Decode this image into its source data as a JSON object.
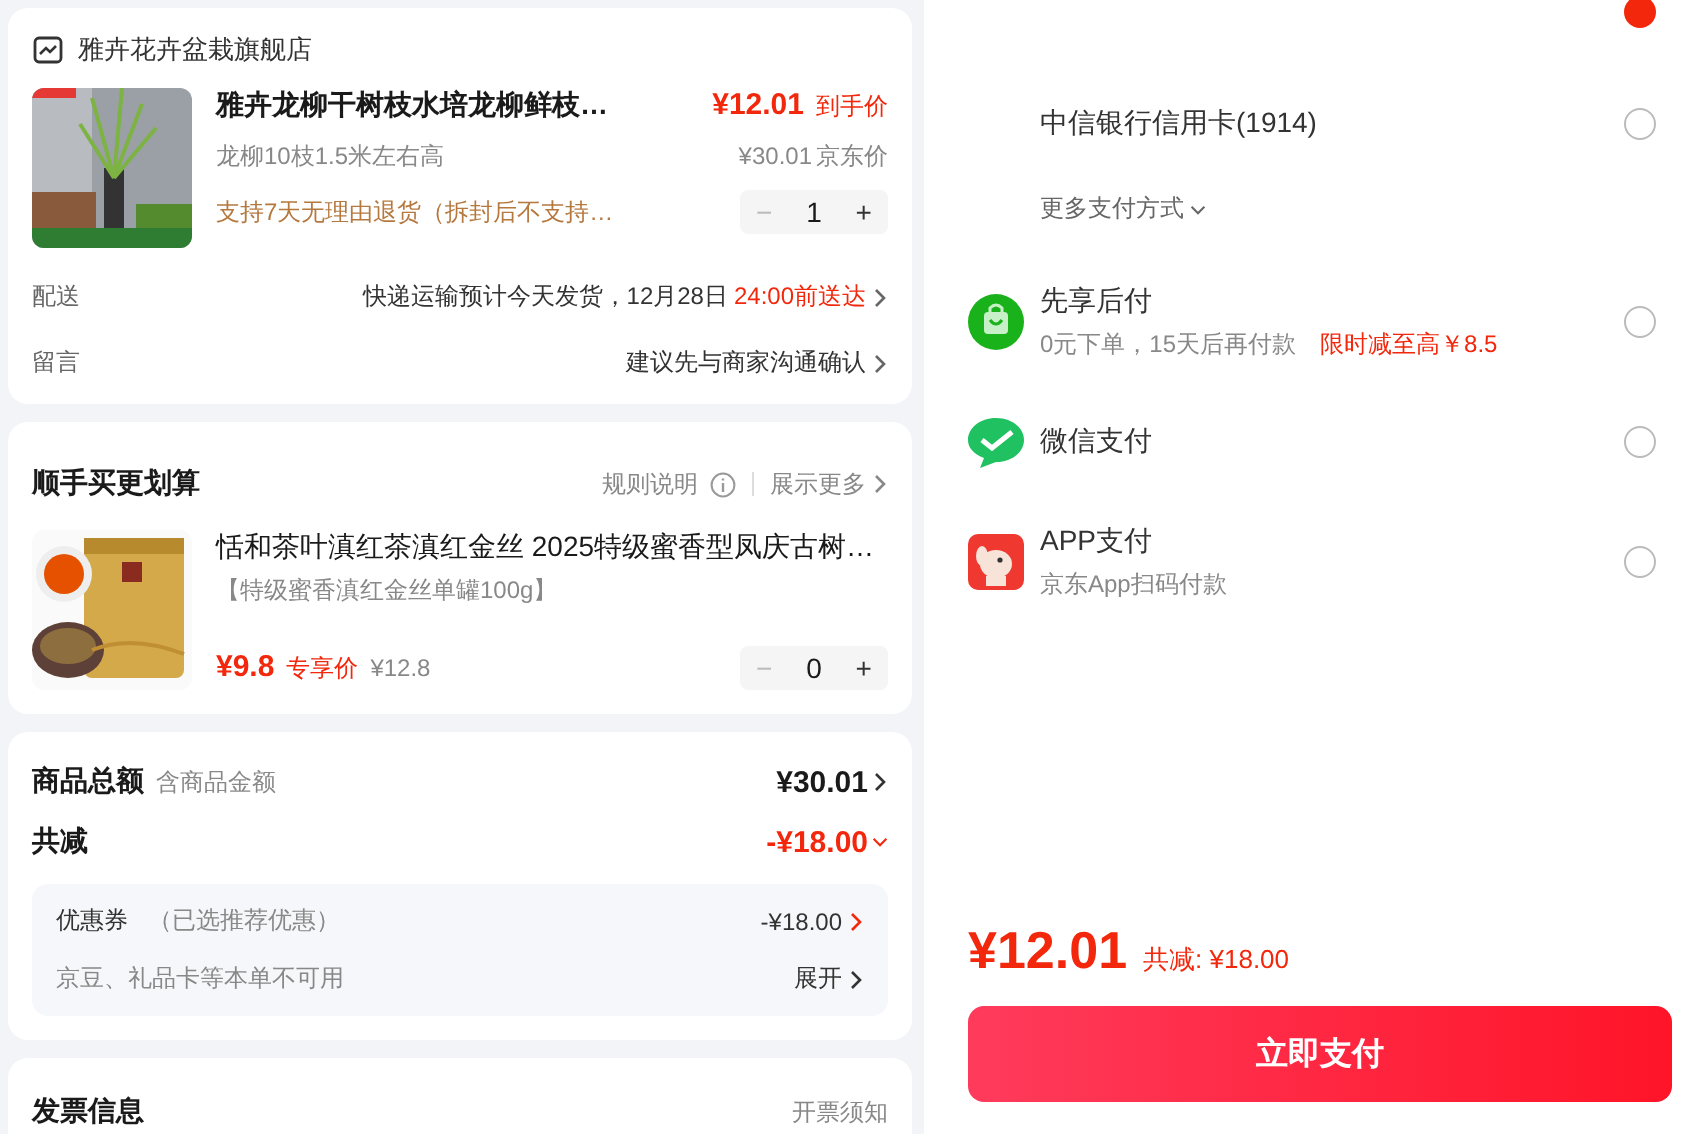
{
  "store": {
    "name": "雅卉花卉盆栽旗舰店"
  },
  "item": {
    "title": "雅卉龙柳干树枝水培龙柳鲜枝…",
    "price": "¥12.01",
    "price_label": "到手价",
    "spec": "龙柳10枝1.5米左右高",
    "list_price": "¥30.01",
    "list_price_label": "京东价",
    "return_policy": "支持7天无理由退货（拆封后不支持…",
    "minus": "−",
    "quantity": "1",
    "plus": "+"
  },
  "details": [
    {
      "label": "配送",
      "value": "快递运输预计今天发货，12月28日",
      "highlight": "24:00前送达"
    },
    {
      "label": "留言",
      "value": "建议先与商家沟通确认"
    }
  ],
  "addon": {
    "title": "顺手买更划算",
    "rules": "规则说明",
    "more": "展示更多",
    "item": {
      "title": "恬和茶叶滇红茶滇红金丝 2025特级蜜香型凤庆古树…",
      "spec": "【特级蜜香滇红金丝单罐100g】",
      "price": "¥9.8",
      "price_label": "专享价",
      "list_price": "¥12.8",
      "minus": "−",
      "quantity": "0",
      "plus": "+"
    }
  },
  "summary": {
    "rows": [
      {
        "kind": "total",
        "label": "商品总额",
        "note": "含商品金额",
        "value": "¥30.01"
      },
      {
        "kind": "discount",
        "label": "共减",
        "value": "-¥18.00"
      }
    ],
    "coupon": {
      "label": "优惠券",
      "note": "（已选推荐优惠）",
      "value": "-¥18.00"
    },
    "beans": {
      "label": "京豆、礼品卡等本单不可用",
      "action": "展开"
    }
  },
  "invoice": {
    "title": "发票信息",
    "notice": "开票须知"
  },
  "payment": {
    "methods": [
      {
        "kind": "clipped",
        "selected": true
      },
      {
        "kind": "card",
        "name": "中信银行信用卡(1914)",
        "selected": false
      }
    ],
    "more": "更多支付方式",
    "other_methods": [
      {
        "kind": "bnpl",
        "name": "先享后付",
        "sub": "0元下单，15天后再付款",
        "promo": "限时减至高￥8.5",
        "selected": false
      },
      {
        "kind": "wechat",
        "name": "微信支付",
        "selected": false
      },
      {
        "kind": "app",
        "name": "APP支付",
        "sub": "京东App扫码付款",
        "selected": false
      }
    ]
  },
  "total": {
    "amount": "¥12.01",
    "saved": "共减: ¥18.00"
  },
  "pay_button": "立即支付"
}
